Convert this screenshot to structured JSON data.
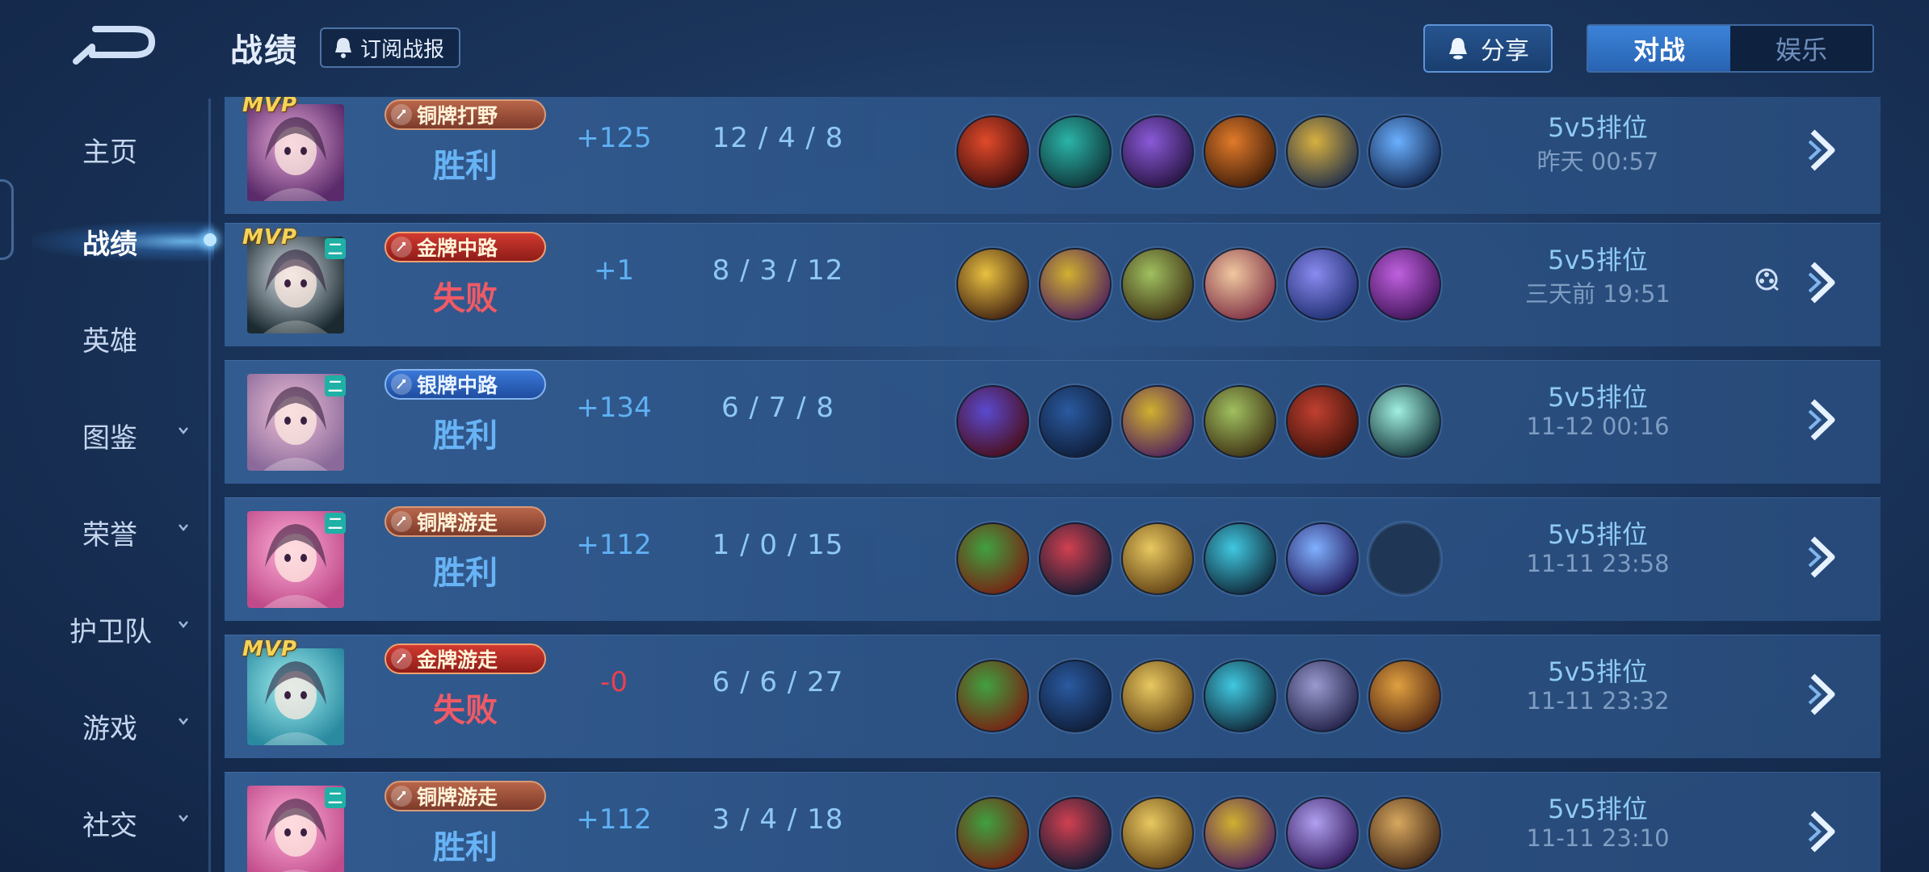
{
  "header": {
    "title": "战绩",
    "subscribe_label": "订阅战报",
    "share_label": "分享",
    "tabs": [
      {
        "label": "对战",
        "active": true
      },
      {
        "label": "娱乐",
        "active": false
      }
    ]
  },
  "sidebar": {
    "items": [
      {
        "label": "主页",
        "active": false,
        "expandable": false
      },
      {
        "label": "战绩",
        "active": true,
        "expandable": false
      },
      {
        "label": "英雄",
        "active": false,
        "expandable": false
      },
      {
        "label": "图鉴",
        "active": false,
        "expandable": true
      },
      {
        "label": "荣誉",
        "active": false,
        "expandable": true
      },
      {
        "label": "护卫队",
        "active": false,
        "expandable": true
      },
      {
        "label": "游戏",
        "active": false,
        "expandable": true
      },
      {
        "label": "社交",
        "active": false,
        "expandable": true
      }
    ]
  },
  "matches": [
    {
      "mvp": true,
      "tag": "",
      "rank": "铜牌打野",
      "rank_tier": "bronze",
      "result": "胜利",
      "win": true,
      "score": "+125",
      "kills": "12",
      "deaths": "4",
      "assists": "8",
      "mode": "5v5排位",
      "time": "昨天 00:57",
      "replay": false,
      "items": [
        [
          "#e04a2a",
          "#3a0c0c"
        ],
        [
          "#2bb4a8",
          "#0d2e33"
        ],
        [
          "#8a5ad8",
          "#22103a"
        ],
        [
          "#e07a2a",
          "#3a1a08"
        ],
        [
          "#d8b040",
          "#1a2a4a"
        ],
        [
          "#6ab0ff",
          "#0d1e44"
        ]
      ],
      "avatar": [
        "#e8a9d8",
        "#5a2a6a"
      ]
    },
    {
      "mvp": true,
      "tag": "二",
      "rank": "金牌中路",
      "rank_tier": "gold",
      "result": "失败",
      "win": false,
      "score": "+1",
      "kills": "8",
      "deaths": "3",
      "assists": "12",
      "mode": "5v5排位",
      "time": "三天前 19:51",
      "replay": true,
      "items": [
        [
          "#e8c040",
          "#3a1a10"
        ],
        [
          "#d0b030",
          "#4a1a60"
        ],
        [
          "#a0c060",
          "#3a2a10"
        ],
        [
          "#f0c8a0",
          "#7a2a40"
        ],
        [
          "#8a8af0",
          "#1a2a6a"
        ],
        [
          "#c060e0",
          "#3a1050"
        ]
      ],
      "avatar": [
        "#d8e0e8",
        "#1a2a30"
      ]
    },
    {
      "mvp": false,
      "tag": "二",
      "rank": "银牌中路",
      "rank_tier": "silver",
      "result": "胜利",
      "win": true,
      "score": "+134",
      "kills": "6",
      "deaths": "7",
      "assists": "8",
      "mode": "5v5排位",
      "time": "11-12 00:16",
      "replay": false,
      "items": [
        [
          "#5a4ad0",
          "#4a0a10"
        ],
        [
          "#2a5aa0",
          "#0d1a33"
        ],
        [
          "#d0b030",
          "#4a1a60"
        ],
        [
          "#a0c060",
          "#3a2a10"
        ],
        [
          "#c04030",
          "#3a1008"
        ],
        [
          "#a0f0e0",
          "#0d2a30"
        ]
      ],
      "avatar": [
        "#f0c0d8",
        "#8a6a9a"
      ]
    },
    {
      "mvp": false,
      "tag": "二",
      "rank": "铜牌游走",
      "rank_tier": "bronze",
      "result": "胜利",
      "win": true,
      "score": "+112",
      "kills": "1",
      "deaths": "0",
      "assists": "15",
      "mode": "5v5排位",
      "time": "11-11 23:58",
      "replay": false,
      "items": [
        [
          "#40a040",
          "#7a1a10"
        ],
        [
          "#d04050",
          "#0d1a33"
        ],
        [
          "#e8c860",
          "#5a3a10"
        ],
        [
          "#40c8e0",
          "#0d2030"
        ],
        [
          "#80b0ff",
          "#1a1050"
        ],
        [
          "",
          ""
        ]
      ],
      "avatar": [
        "#ffb0d8",
        "#c04a8a"
      ]
    },
    {
      "mvp": true,
      "tag": "",
      "rank": "金牌游走",
      "rank_tier": "gold",
      "result": "失败",
      "win": false,
      "score": "-0",
      "kills": "6",
      "deaths": "6",
      "assists": "27",
      "mode": "5v5排位",
      "time": "11-11 23:32",
      "replay": false,
      "items": [
        [
          "#40a040",
          "#7a1a10"
        ],
        [
          "#2a5aa0",
          "#0d1a33"
        ],
        [
          "#e8c860",
          "#5a3a10"
        ],
        [
          "#40c8e0",
          "#0d2030"
        ],
        [
          "#9a9ad0",
          "#1a1a40"
        ],
        [
          "#e0a040",
          "#4a2010"
        ]
      ],
      "avatar": [
        "#a0f0f0",
        "#2a8aa0"
      ]
    },
    {
      "mvp": false,
      "tag": "二",
      "rank": "铜牌游走",
      "rank_tier": "bronze",
      "result": "胜利",
      "win": true,
      "score": "+112",
      "kills": "3",
      "deaths": "4",
      "assists": "18",
      "mode": "5v5排位",
      "time": "11-11 23:10",
      "replay": false,
      "items": [
        [
          "#40a040",
          "#7a1a10"
        ],
        [
          "#d04050",
          "#0d1a33"
        ],
        [
          "#e8c860",
          "#5a3a10"
        ],
        [
          "#d0b030",
          "#4a1a60"
        ],
        [
          "#b0a0f0",
          "#2a1050"
        ],
        [
          "#d8a860",
          "#3a2010"
        ]
      ],
      "avatar": [
        "#ffb0d8",
        "#c04a8a"
      ]
    }
  ]
}
